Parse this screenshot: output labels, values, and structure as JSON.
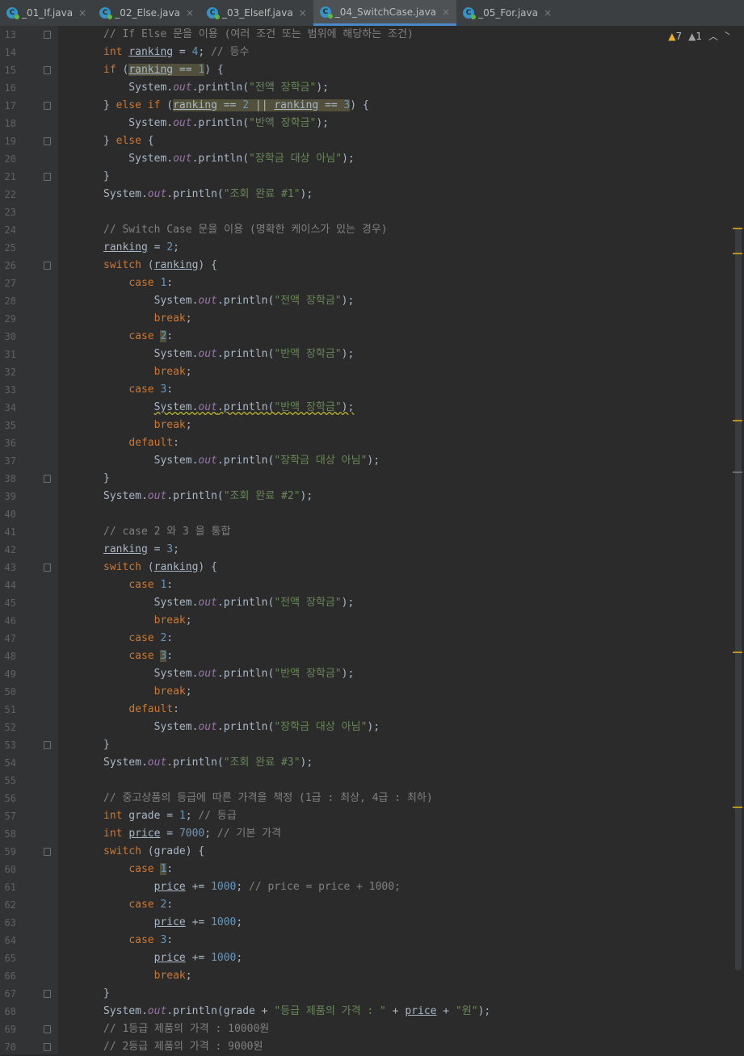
{
  "tabs": [
    {
      "label": "_01_If.java",
      "active": false
    },
    {
      "label": "_02_Else.java",
      "active": false
    },
    {
      "label": "_03_ElseIf.java",
      "active": false
    },
    {
      "label": "_04_SwitchCase.java",
      "active": true
    },
    {
      "label": "_05_For.java",
      "active": false
    }
  ],
  "indicators": {
    "warnings": "7",
    "weak_warnings": "1"
  },
  "colors": {
    "keyword": "#cc7832",
    "number": "#6897bb",
    "string": "#6a8759",
    "comment": "#808080",
    "field": "#9876aa"
  },
  "line_numbers": [
    "13",
    "14",
    "15",
    "16",
    "17",
    "18",
    "19",
    "20",
    "21",
    "22",
    "23",
    "24",
    "25",
    "26",
    "27",
    "28",
    "29",
    "30",
    "31",
    "32",
    "33",
    "34",
    "35",
    "36",
    "37",
    "38",
    "39",
    "40",
    "41",
    "42",
    "43",
    "44",
    "45",
    "46",
    "47",
    "48",
    "49",
    "50",
    "51",
    "52",
    "53",
    "54",
    "55",
    "56",
    "57",
    "58",
    "59",
    "60",
    "61",
    "62",
    "63",
    "64",
    "65",
    "66",
    "67",
    "68",
    "69",
    "70"
  ],
  "code": {
    "c13": "// If Else 문을 이용 (여러 조건 또는 범위에 해당하는 조건)",
    "c24": "// Switch Case 문을 이용 (명확한 케이스가 있는 경우)",
    "c41": "// case 2 와 3 을 통합",
    "c56": "// 중고상품의 등급에 따른 가격을 책정 (1급 : 최상, 4급 : 최하)",
    "c14": "// 등수",
    "c57": "// 등급",
    "c58": "// 기본 가격",
    "c61": "// price = price + 1000;",
    "c69": "// 1등급 제품의 가격 : 10000원",
    "c70": "// 2등급 제품의 가격 : 9000원",
    "s_full": "\"전액 장학금\"",
    "s_half": "\"반액 장학금\"",
    "s_none": "\"장학금 대상 아님\"",
    "s_done1": "\"조회 완료 #1\"",
    "s_done2": "\"조회 완료 #2\"",
    "s_done3": "\"조회 완료 #3\"",
    "s_grade": "\"등급 제품의 가격 : \"",
    "s_won": "\"원\""
  }
}
